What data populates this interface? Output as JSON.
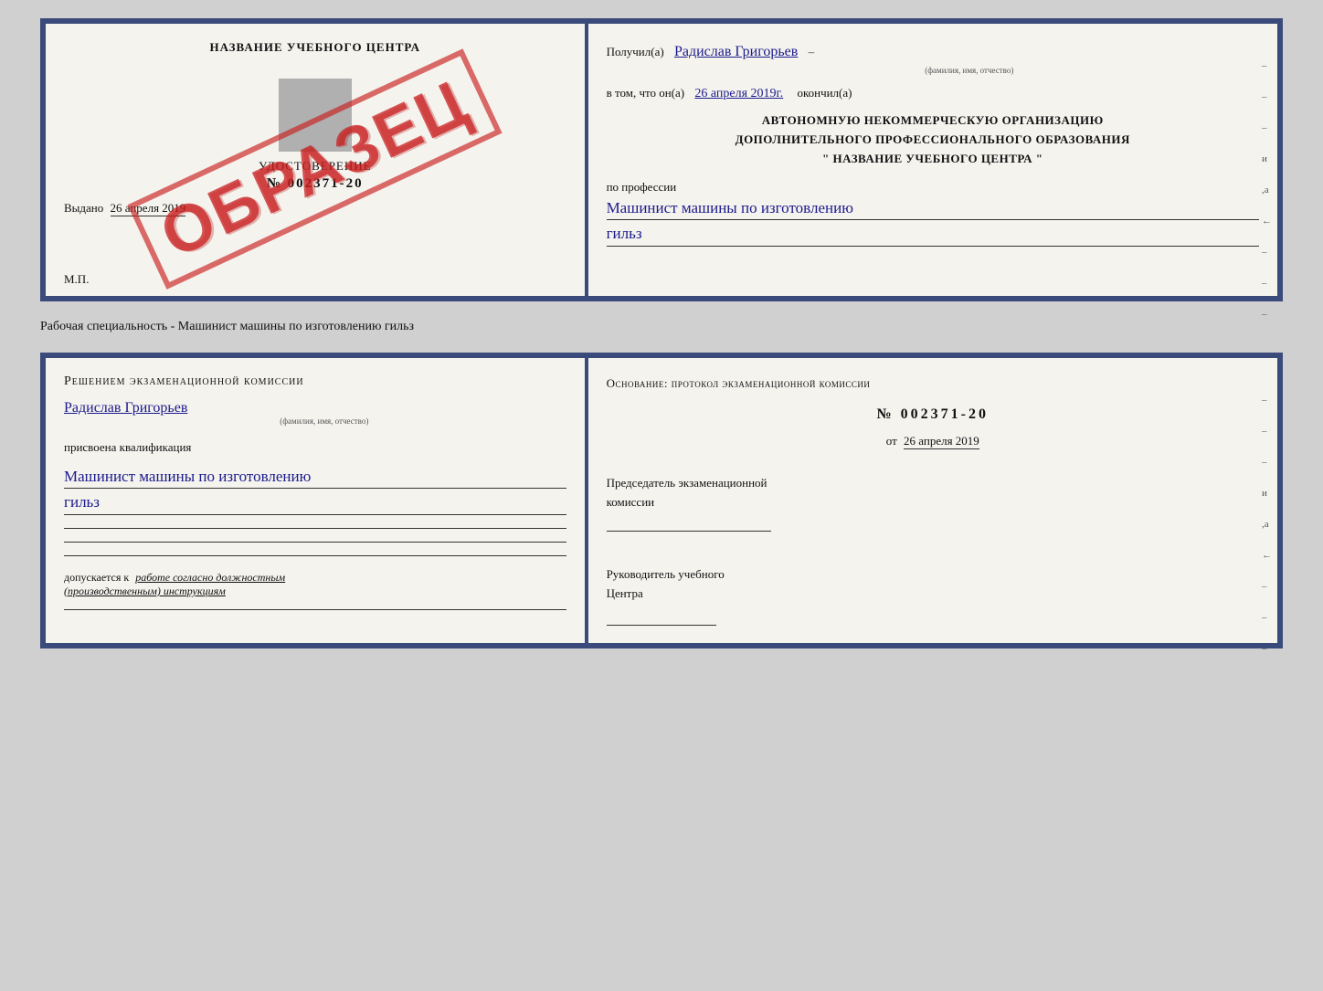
{
  "top_document": {
    "left": {
      "title": "НАЗВАНИЕ УЧЕБНОГО ЦЕНТРА",
      "obrazec": "ОБРАЗЕЦ",
      "cert_label": "УДОСТОВЕРЕНИЕ",
      "cert_number": "№ 002371-20",
      "issued_label": "Выдано",
      "issued_date": "26 апреля 2019",
      "mp_label": "М.П."
    },
    "right": {
      "received_label": "Получил(а)",
      "recipient_name": "Радислав Григорьев",
      "name_caption": "(фамилия, имя, отчество)",
      "date_label": "в том, что он(а)",
      "date_value": "26 апреля 2019г.",
      "finished_label": "окончил(а)",
      "org_line1": "АВТОНОМНУЮ НЕКОММЕРЧЕСКУЮ ОРГАНИЗАЦИЮ",
      "org_line2": "ДОПОЛНИТЕЛЬНОГО ПРОФЕССИОНАЛЬНОГО ОБРАЗОВАНИЯ",
      "org_line3": "\"  НАЗВАНИЕ УЧЕБНОГО ЦЕНТРА  \"",
      "profession_label": "по профессии",
      "profession_value": "Машинист машины по изготовлению",
      "profession_line2": "гильз",
      "edge_marks": [
        "–",
        "–",
        "–",
        "и",
        ",а",
        "←",
        "–",
        "–",
        "–"
      ]
    }
  },
  "middle_label": "Рабочая специальность - Машинист машины по изготовлению гильз",
  "bottom_document": {
    "left": {
      "decision_header": "Решением  экзаменационной  комиссии",
      "person_name": "Радислав Григорьев",
      "name_caption": "(фамилия, имя, отчество)",
      "qualification_label": "присвоена квалификация",
      "qualification_value": "Машинист машины по изготовлению",
      "qualification_line2": "гильз",
      "допускается_label": "допускается к",
      "допускается_value": "работе согласно должностным",
      "допускается_line2": "(производственным) инструкциям"
    },
    "right": {
      "basis_label": "Основание: протокол экзаменационной  комиссии",
      "number": "№  002371-20",
      "date_label": "от",
      "date_value": "26 апреля 2019",
      "chairman_label": "Председатель экзаменационной",
      "chairman_label2": "комиссии",
      "head_label": "Руководитель учебного",
      "head_label2": "Центра",
      "edge_marks": [
        "–",
        "–",
        "–",
        "и",
        ",а",
        "←",
        "–",
        "–",
        "–"
      ]
    }
  }
}
